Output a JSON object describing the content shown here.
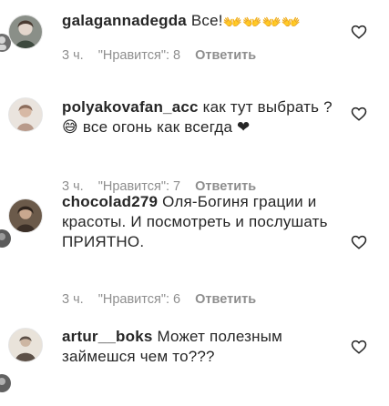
{
  "comments": [
    {
      "username": "galagannadegda",
      "text": "Все!",
      "text_emoji": "👐👐👐👐",
      "time": "3 ч.",
      "likes": "\"Нравится\": 8",
      "reply": "Ответить",
      "avatar_colors": [
        "#8a8f88",
        "#3e4a3f"
      ]
    },
    {
      "username": "polyakovafan_acc",
      "text": "как тут выбрать ? 😅 все огонь как всегда ❤",
      "time": "3 ч.",
      "likes": "\"Нравится\": 7",
      "reply": "Ответить",
      "avatar_colors": [
        "#d9cfc7",
        "#b89a8a"
      ]
    },
    {
      "username": "chocolad279",
      "text": "Оля-Богиня грации и красоты. И посмотреть и послушать ПРИЯТНО.",
      "time": "3 ч.",
      "likes": "\"Нравится\": 6",
      "reply": "Ответить",
      "avatar_colors": [
        "#6b5a4a",
        "#3b2f27"
      ]
    },
    {
      "username": "artur__boks",
      "text": "Может полезным займешся чем то???",
      "avatar_colors": [
        "#e9e3da",
        "#5c5047"
      ]
    }
  ],
  "colors": {
    "text": "#262626",
    "meta": "#8e8e8e",
    "heart_stroke": "#262626"
  }
}
